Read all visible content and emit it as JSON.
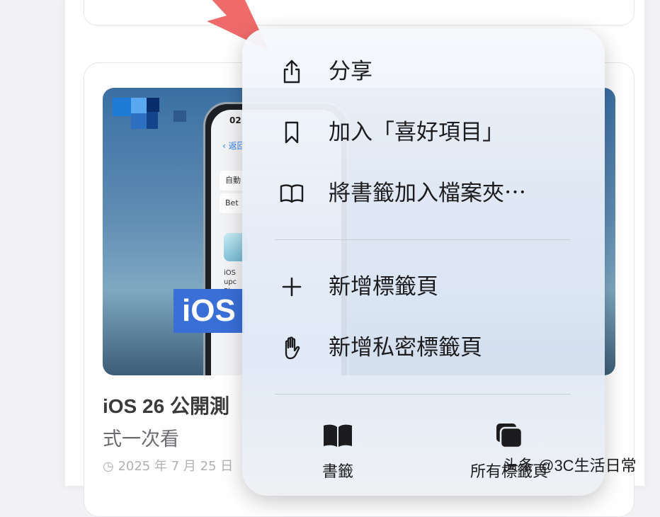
{
  "article": {
    "title_line1": "iOS 26 公開測",
    "title_line2": "式一次看",
    "date": "2025 年 7 月 25 日",
    "thumbnail": {
      "badge_text": "iOS",
      "phone_time": "02",
      "phone_back_label": "返回",
      "phone_row1": "自動",
      "phone_row2": "Bet",
      "phone_text_lines": "iOS\nupc\nPle"
    }
  },
  "context_menu": {
    "items": [
      {
        "label": "分享",
        "icon": "share-icon"
      },
      {
        "label": "加入「喜好項目」",
        "icon": "bookmark-icon"
      },
      {
        "label": "將書籤加入檔案夾⋯",
        "icon": "book-open-icon"
      },
      {
        "label": "新增標籤頁",
        "icon": "plus-icon"
      },
      {
        "label": "新增私密標籤頁",
        "icon": "hand-icon"
      }
    ],
    "bottom_buttons": [
      {
        "label": "書籤",
        "icon": "book-filled-icon"
      },
      {
        "label": "所有標籤頁",
        "icon": "tabs-icon"
      }
    ]
  },
  "watermark": "头条 @3C生活日常",
  "colors": {
    "pointer_arrow": "#ef6b6b",
    "ios_badge": "#3a6fd8",
    "text_primary": "#1c1c1e"
  }
}
